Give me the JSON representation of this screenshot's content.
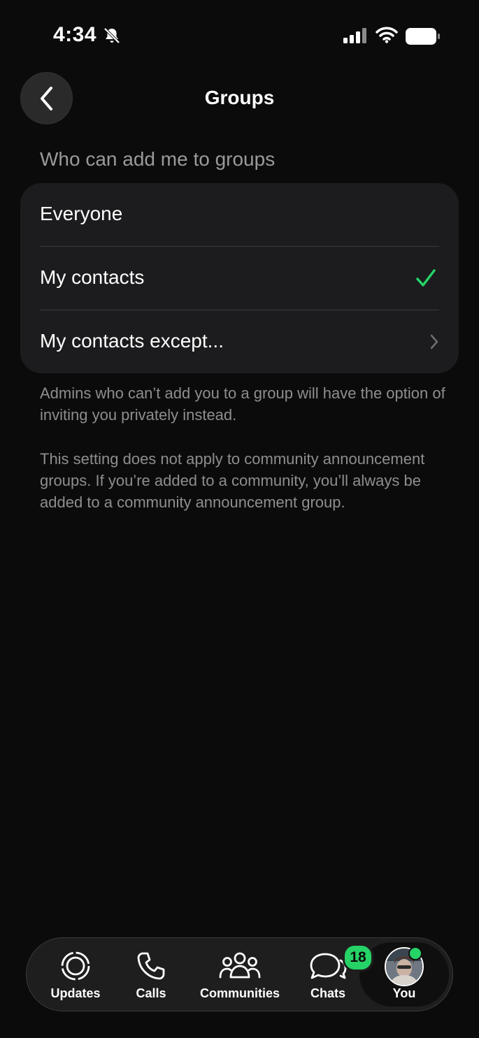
{
  "status_bar": {
    "time": "4:34"
  },
  "header": {
    "title": "Groups"
  },
  "section": {
    "title": "Who can add me to groups"
  },
  "options": [
    {
      "label": "Everyone"
    },
    {
      "label": "My contacts"
    },
    {
      "label": "My contacts except..."
    }
  ],
  "selected_option": "My contacts",
  "footnotes": [
    "Admins who can’t add you to a group will have the option of inviting you privately instead.",
    "This setting does not apply to community announcement groups. If you’re added to a community, you’ll always be added to a community announcement group."
  ],
  "tabs": [
    {
      "label": "Updates",
      "icon": "updates-icon"
    },
    {
      "label": "Calls",
      "icon": "phone-icon"
    },
    {
      "label": "Communities",
      "icon": "communities-icon"
    },
    {
      "label": "Chats",
      "icon": "chats-icon",
      "badge": "18"
    },
    {
      "label": "You",
      "icon": "avatar"
    }
  ],
  "colors": {
    "accent": "#25d366",
    "background": "#0b0b0b",
    "card": "#1c1c1e"
  }
}
